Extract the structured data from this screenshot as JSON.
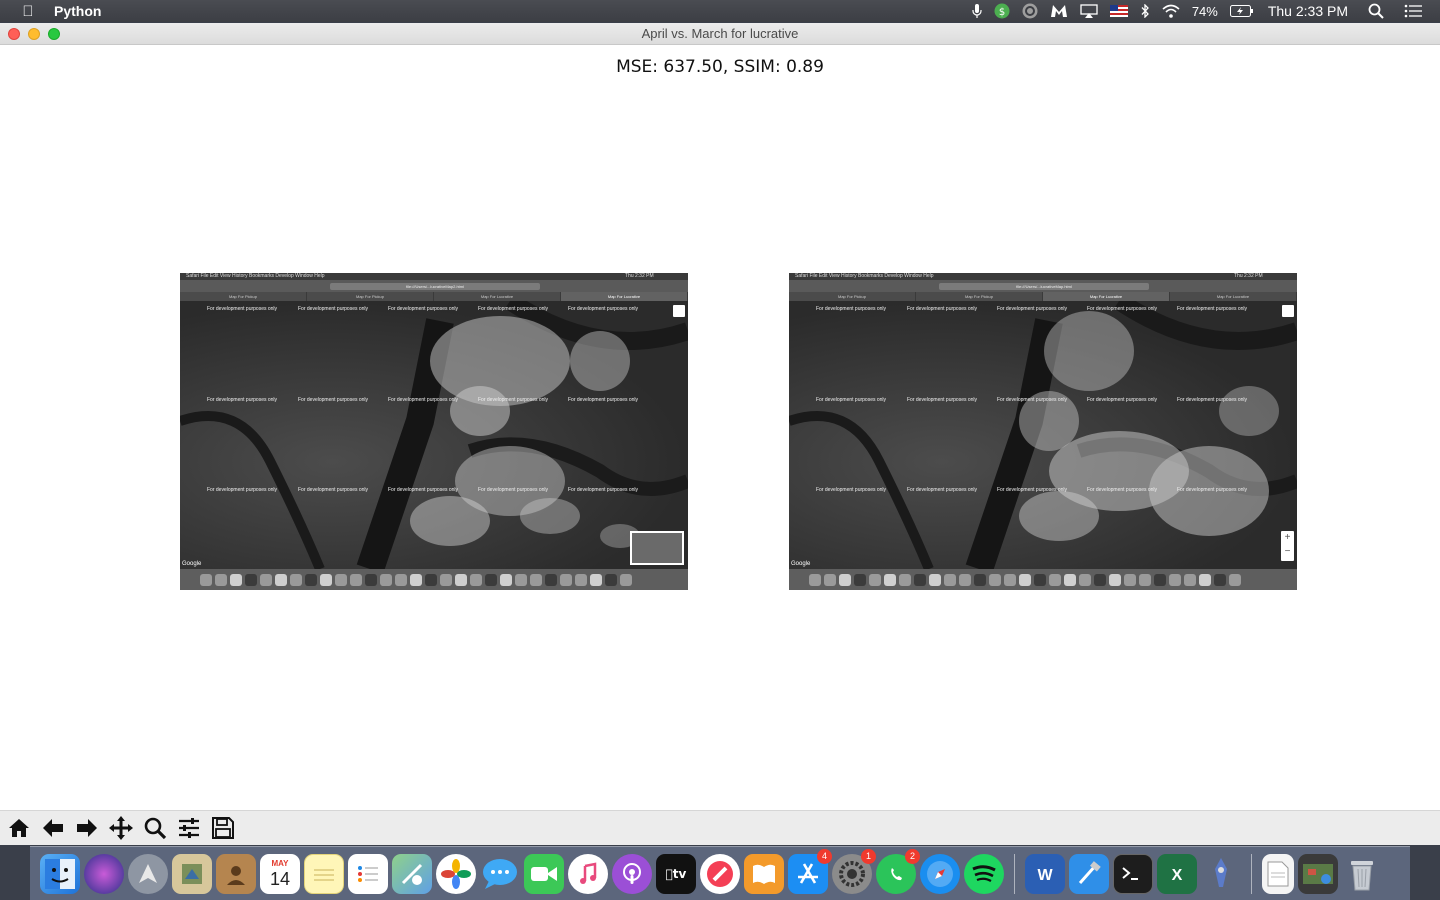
{
  "menubar": {
    "app_name": "Python",
    "battery_percent": "74%",
    "clock": "Thu 2:33 PM"
  },
  "window": {
    "title": "April vs. March for lucrative"
  },
  "figure": {
    "title": "MSE: 637.50, SSIM: 0.89",
    "left_image": {
      "menu_items": "Safari   File   Edit   View   History   Bookmarks   Develop   Window   Help",
      "clock": "Thu 2:32 PM",
      "url": "file:///Users/...lucrativeMap2.html",
      "tabs": [
        "Map For Pickup",
        "Map For Pickup",
        "Map For Lucrative",
        "Map For Lucrative"
      ],
      "active_tab": 3,
      "watermark": "For development purposes only",
      "google": "Google"
    },
    "right_image": {
      "menu_items": "Safari   File   Edit   View   History   Bookmarks   Develop   Window   Help",
      "clock": "Thu 2:32 PM",
      "url": "file:///Users/...lucrativeMap.html",
      "tabs": [
        "Map For Pickup",
        "Map For Pickup",
        "Map For Lucrative",
        "Map For Lucrative"
      ],
      "active_tab": 2,
      "watermark": "For development purposes only",
      "google": "Google"
    }
  },
  "toolbar": {
    "buttons": [
      "home-icon",
      "back-arrow-icon",
      "forward-arrow-icon",
      "pan-icon",
      "zoom-icon",
      "configure-subplots-icon",
      "save-icon"
    ]
  },
  "dock": {
    "calendar_month": "MAY",
    "calendar_day": "14",
    "badges": {
      "app_store": "4",
      "system_preferences": "1",
      "whatsapp": "2"
    }
  }
}
